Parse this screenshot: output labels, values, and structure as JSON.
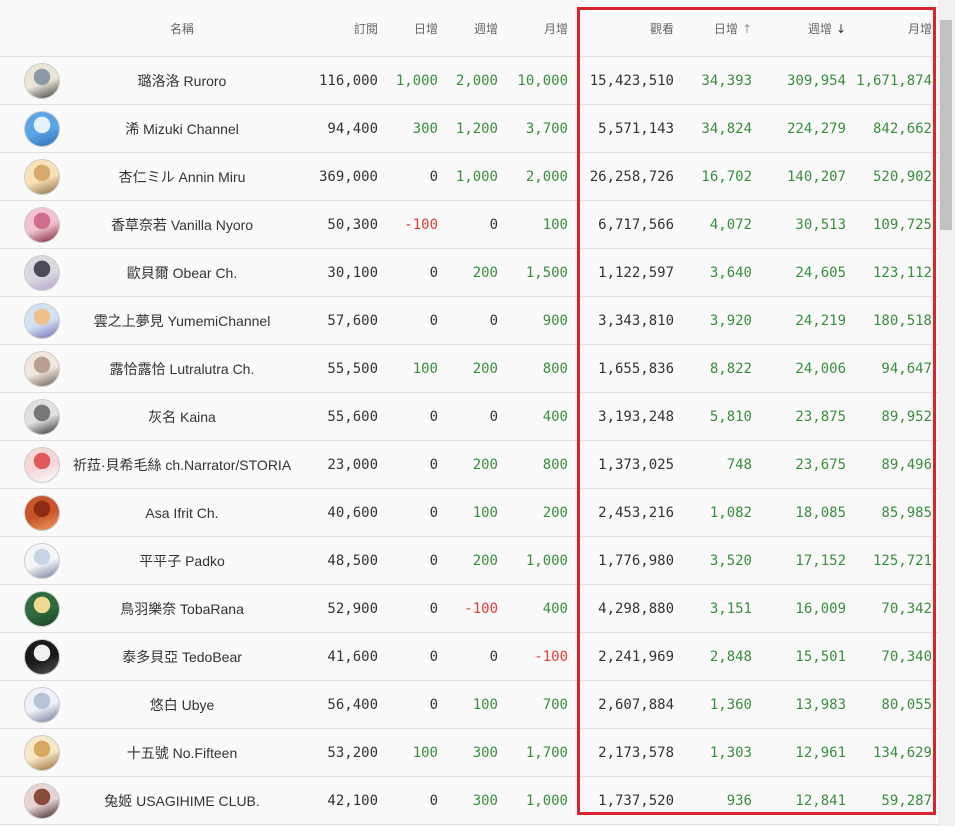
{
  "header": {
    "name": "名稱",
    "subs": "訂閱",
    "subs_day": "日增",
    "subs_week": "週增",
    "subs_month": "月增",
    "views": "觀看",
    "views_day": "日增",
    "views_week": "週增",
    "views_month": "月增"
  },
  "sort": {
    "views_day_icon": "↑",
    "views_week_icon": "↓"
  },
  "colors": {
    "positive": "#388e3c",
    "negative": "#e53935",
    "highlight": "#d9232f"
  },
  "rows": [
    {
      "name": "璐洛洛 Ruroro",
      "subs": "116,000",
      "sd": "1,000",
      "sw": "2,000",
      "sm": "10,000",
      "views": "15,423,510",
      "vd": "34,393",
      "vw": "309,954",
      "vm": "1,671,874",
      "av": [
        "#e9e6d6",
        "#8a9aa6",
        "#3b3b3b"
      ]
    },
    {
      "name": "浠 Mizuki Channel",
      "subs": "94,400",
      "sd": "300",
      "sw": "1,200",
      "sm": "3,700",
      "views": "5,571,143",
      "vd": "34,824",
      "vw": "224,279",
      "vm": "842,662",
      "av": [
        "#5aa6e6",
        "#e8f1fb",
        "#2a6fb5"
      ]
    },
    {
      "name": "杏仁ミル Annin Miru",
      "subs": "369,000",
      "sd": "0",
      "sw": "1,000",
      "sm": "2,000",
      "views": "26,258,726",
      "vd": "16,702",
      "vw": "140,207",
      "vm": "520,902",
      "av": [
        "#f7e3b6",
        "#d9a86c",
        "#8c6a46"
      ]
    },
    {
      "name": "香草奈若 Vanilla Nyoro",
      "subs": "50,300",
      "sd": "-100",
      "sw": "0",
      "sm": "100",
      "views": "6,717,566",
      "vd": "4,072",
      "vw": "30,513",
      "vm": "109,725",
      "av": [
        "#f2c2d0",
        "#d06c8c",
        "#7a2338"
      ]
    },
    {
      "name": "歐貝爾 Obear Ch.",
      "subs": "30,100",
      "sd": "0",
      "sw": "200",
      "sm": "1,500",
      "views": "1,122,597",
      "vd": "3,640",
      "vw": "24,605",
      "vm": "123,112",
      "av": [
        "#d9d9e0",
        "#4a4a58",
        "#b8a4cf"
      ]
    },
    {
      "name": "雲之上夢見 YumemiChannel",
      "subs": "57,600",
      "sd": "0",
      "sw": "0",
      "sm": "900",
      "views": "3,343,810",
      "vd": "3,920",
      "vw": "24,219",
      "vm": "180,518",
      "av": [
        "#cfe3f5",
        "#f0c08a",
        "#7a6ab0"
      ]
    },
    {
      "name": "露恰露恰 Lutralutra Ch.",
      "subs": "55,500",
      "sd": "100",
      "sw": "200",
      "sm": "800",
      "views": "1,655,836",
      "vd": "8,822",
      "vw": "24,006",
      "vm": "94,647",
      "av": [
        "#efe6dc",
        "#b9a090",
        "#6c5a50"
      ]
    },
    {
      "name": "灰名 Kaina",
      "subs": "55,600",
      "sd": "0",
      "sw": "0",
      "sm": "400",
      "views": "3,193,248",
      "vd": "5,810",
      "vw": "23,875",
      "vm": "89,952",
      "av": [
        "#e0e0e0",
        "#777777",
        "#333333"
      ]
    },
    {
      "name": "祈菈·貝希毛絲 ch.Narrator/STORIA",
      "subs": "23,000",
      "sd": "0",
      "sw": "200",
      "sm": "800",
      "views": "1,373,025",
      "vd": "748",
      "vw": "23,675",
      "vm": "89,496",
      "av": [
        "#f4d8d8",
        "#e05a5a",
        "#fafafa"
      ]
    },
    {
      "name": "Asa Ifrit Ch.",
      "subs": "40,600",
      "sd": "0",
      "sw": "100",
      "sm": "200",
      "views": "2,453,216",
      "vd": "1,082",
      "vw": "18,085",
      "vm": "85,985",
      "av": [
        "#c9542c",
        "#8a2d14",
        "#f0a060"
      ]
    },
    {
      "name": "平平子 Padko",
      "subs": "48,500",
      "sd": "0",
      "sw": "200",
      "sm": "1,000",
      "views": "1,776,980",
      "vd": "3,520",
      "vw": "17,152",
      "vm": "125,721",
      "av": [
        "#f4f6fa",
        "#c9d4e6",
        "#6a7a96"
      ]
    },
    {
      "name": "鳥羽樂奈 TobaRana",
      "subs": "52,900",
      "sd": "0",
      "sw": "-100",
      "sm": "400",
      "views": "4,298,880",
      "vd": "3,151",
      "vw": "16,009",
      "vm": "70,342",
      "av": [
        "#2f6b3e",
        "#f0d890",
        "#1d3f25"
      ]
    },
    {
      "name": "泰多貝亞 TedoBear",
      "subs": "41,600",
      "sd": "0",
      "sw": "0",
      "sm": "-100",
      "views": "2,241,969",
      "vd": "2,848",
      "vw": "15,501",
      "vm": "70,340",
      "av": [
        "#1a1a1a",
        "#f0f0f0",
        "#555555"
      ]
    },
    {
      "name": "悠白 Ubye",
      "subs": "56,400",
      "sd": "0",
      "sw": "100",
      "sm": "700",
      "views": "2,607,884",
      "vd": "1,360",
      "vw": "13,983",
      "vm": "80,055",
      "av": [
        "#eef1f8",
        "#b8c2d8",
        "#6c7896"
      ]
    },
    {
      "name": "十五號 No.Fifteen",
      "subs": "53,200",
      "sd": "100",
      "sw": "300",
      "sm": "1,700",
      "views": "2,173,578",
      "vd": "1,303",
      "vw": "12,961",
      "vm": "134,629",
      "av": [
        "#f7e8c8",
        "#d8a860",
        "#9a6a30"
      ]
    },
    {
      "name": "兔姬 USAGIHIME CLUB.",
      "subs": "42,100",
      "sd": "0",
      "sw": "300",
      "sm": "1,000",
      "views": "1,737,520",
      "vd": "936",
      "vw": "12,841",
      "vm": "59,287",
      "av": [
        "#e8d4d4",
        "#8a4a3a",
        "#3a2020"
      ]
    }
  ]
}
